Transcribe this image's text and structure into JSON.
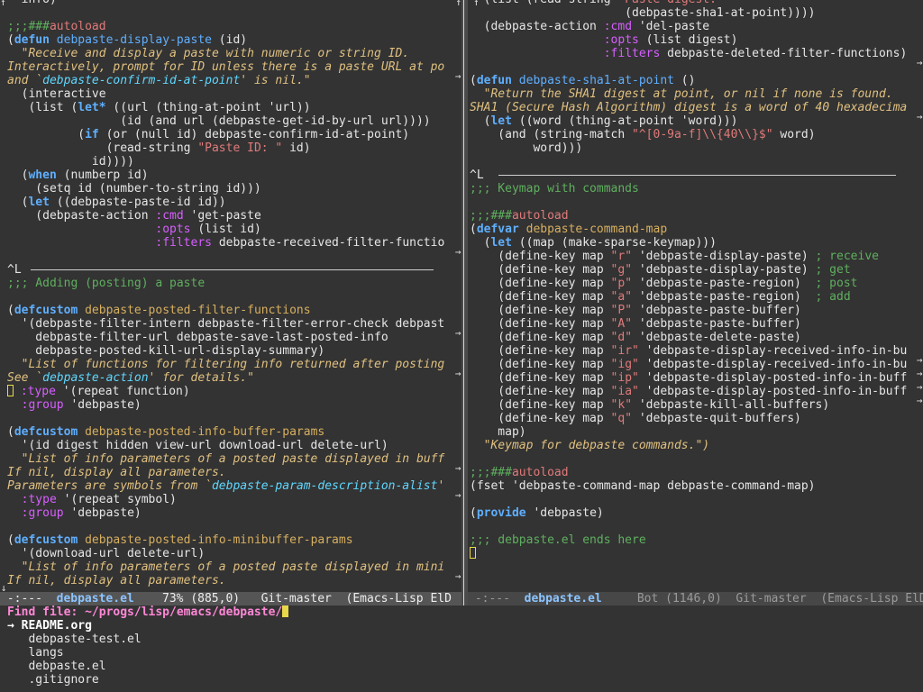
{
  "left_window": {
    "lines": [
      [
        {
          "t": "  info)"
        }
      ],
      [
        {
          "t": ""
        }
      ],
      [
        {
          "t": ";;;###",
          "c": "cm"
        },
        {
          "t": "autoload",
          "c": "str"
        }
      ],
      [
        {
          "t": "(",
          "c": ""
        },
        {
          "t": "defun",
          "c": "kw"
        },
        {
          "t": " ",
          "c": ""
        },
        {
          "t": "debpaste-display-paste",
          "c": "fn"
        },
        {
          "t": " (id)"
        }
      ],
      [
        {
          "t": "  \"Receive and display a paste with numeric or string ID.",
          "c": "doc"
        }
      ],
      [
        {
          "t": "Interactively, prompt for ID unless there is a paste URL at po",
          "c": "doc"
        }
      ],
      [
        {
          "t": "and `",
          "c": "doc"
        },
        {
          "t": "debpaste-confirm-id-at-point",
          "c": "link"
        },
        {
          "t": "' is nil.\"",
          "c": "doc"
        }
      ],
      [
        {
          "t": "  (interactive"
        }
      ],
      [
        {
          "t": "   (list ("
        },
        {
          "t": "let*",
          "c": "kw"
        },
        {
          "t": " ((url (thing-at-point 'url))"
        }
      ],
      [
        {
          "t": "                (id (and url (debpaste-get-id-by-url url))))"
        }
      ],
      [
        {
          "t": "          ("
        },
        {
          "t": "if",
          "c": "kw"
        },
        {
          "t": " (or (null id) debpaste-confirm-id-at-point)"
        }
      ],
      [
        {
          "t": "              (read-string "
        },
        {
          "t": "\"Paste ID: \"",
          "c": "str"
        },
        {
          "t": " id)"
        }
      ],
      [
        {
          "t": "            id))))"
        }
      ],
      [
        {
          "t": "  ("
        },
        {
          "t": "when",
          "c": "kw"
        },
        {
          "t": " (numberp id)"
        }
      ],
      [
        {
          "t": "    (setq id (number-to-string id)))"
        }
      ],
      [
        {
          "t": "  ("
        },
        {
          "t": "let",
          "c": "kw"
        },
        {
          "t": " ((debpaste-paste-id id))"
        }
      ],
      [
        {
          "t": "    (debpaste-action "
        },
        {
          "t": ":cmd",
          "c": "cmd"
        },
        {
          "t": " 'get-paste"
        }
      ],
      [
        {
          "t": "                     "
        },
        {
          "t": ":opts",
          "c": "cmd"
        },
        {
          "t": " (list id)"
        }
      ],
      [
        {
          "t": "                     "
        },
        {
          "t": ":filters",
          "c": "cmd"
        },
        {
          "t": " debpaste-received-filter-functio"
        }
      ],
      [
        {
          "t": ""
        }
      ],
      [
        {
          "t": "^L",
          "ff": true
        }
      ],
      [
        {
          "t": ";;; Adding (posting) a paste",
          "c": "cm"
        }
      ],
      [
        {
          "t": ""
        }
      ],
      [
        {
          "t": "(",
          "c": ""
        },
        {
          "t": "defcustom",
          "c": "kw"
        },
        {
          "t": " "
        },
        {
          "t": "debpaste-posted-filter-functions",
          "c": "var"
        }
      ],
      [
        {
          "t": "  '(debpaste-filter-intern debpaste-filter-error-check debpast"
        }
      ],
      [
        {
          "t": "    debpaste-filter-url debpaste-save-last-posted-info"
        }
      ],
      [
        {
          "t": "    debpaste-posted-kill-url-display-summary)"
        }
      ],
      [
        {
          "t": "  \"List of functions for filtering info returned after posting",
          "c": "doc"
        }
      ],
      [
        {
          "t": "See `",
          "c": "doc"
        },
        {
          "t": "debpaste-action",
          "c": "link"
        },
        {
          "t": "' for details.\"",
          "c": "doc"
        }
      ],
      [
        {
          "t": "",
          "cur": true
        },
        {
          "t": " "
        },
        {
          "t": ":type",
          "c": "cmd"
        },
        {
          "t": " '(repeat function)"
        }
      ],
      [
        {
          "t": "  "
        },
        {
          "t": ":group",
          "c": "cmd"
        },
        {
          "t": " 'debpaste)"
        }
      ],
      [
        {
          "t": ""
        }
      ],
      [
        {
          "t": "(",
          "c": ""
        },
        {
          "t": "defcustom",
          "c": "kw"
        },
        {
          "t": " "
        },
        {
          "t": "debpaste-posted-info-buffer-params",
          "c": "var"
        }
      ],
      [
        {
          "t": "  '(id digest hidden view-url download-url delete-url)"
        }
      ],
      [
        {
          "t": "  \"List of info parameters of a posted paste displayed in buff",
          "c": "doc"
        }
      ],
      [
        {
          "t": "If nil, display all parameters.",
          "c": "doc"
        }
      ],
      [
        {
          "t": "Parameters are symbols from `",
          "c": "doc"
        },
        {
          "t": "debpaste-param-description-alist",
          "c": "link"
        },
        {
          "t": "'",
          "c": "doc"
        }
      ],
      [
        {
          "t": "  "
        },
        {
          "t": ":type",
          "c": "cmd"
        },
        {
          "t": " '(repeat symbol)"
        }
      ],
      [
        {
          "t": "  "
        },
        {
          "t": ":group",
          "c": "cmd"
        },
        {
          "t": " 'debpaste)"
        }
      ],
      [
        {
          "t": ""
        }
      ],
      [
        {
          "t": "(",
          "c": ""
        },
        {
          "t": "defcustom",
          "c": "kw"
        },
        {
          "t": " "
        },
        {
          "t": "debpaste-posted-info-minibuffer-params",
          "c": "var"
        }
      ],
      [
        {
          "t": "  '(download-url delete-url)"
        }
      ],
      [
        {
          "t": "  \"List of info parameters of a posted paste displayed in mini",
          "c": "doc"
        }
      ],
      [
        {
          "t": "If nil, display all parameters.",
          "c": "doc"
        }
      ]
    ]
  },
  "right_window": {
    "lines": [
      [
        {
          "t": "  (list (read-string "
        },
        {
          "t": "\"Paste digest: \"",
          "c": "str"
        }
      ],
      [
        {
          "t": "                      (debpaste-sha1-at-point))))"
        }
      ],
      [
        {
          "t": "  (debpaste-action "
        },
        {
          "t": ":cmd",
          "c": "cmd"
        },
        {
          "t": " 'del-paste"
        }
      ],
      [
        {
          "t": "                   "
        },
        {
          "t": ":opts",
          "c": "cmd"
        },
        {
          "t": " (list digest)"
        }
      ],
      [
        {
          "t": "                   "
        },
        {
          "t": ":filters",
          "c": "cmd"
        },
        {
          "t": " debpaste-deleted-filter-functions)"
        }
      ],
      [
        {
          "t": ""
        }
      ],
      [
        {
          "t": "(",
          "c": ""
        },
        {
          "t": "defun",
          "c": "kw"
        },
        {
          "t": " "
        },
        {
          "t": "debpaste-sha1-at-point",
          "c": "fn"
        },
        {
          "t": " ()"
        }
      ],
      [
        {
          "t": "  \"Return the SHA1 digest at point, or nil if none is found.",
          "c": "doc"
        }
      ],
      [
        {
          "t": "SHA1 (Secure Hash Algorithm) digest is a word of 40 hexadecima",
          "c": "doc"
        }
      ],
      [
        {
          "t": "  ("
        },
        {
          "t": "let",
          "c": "kw"
        },
        {
          "t": " ((word (thing-at-point 'word)))"
        }
      ],
      [
        {
          "t": "    (and (string-match "
        },
        {
          "t": "\"^[0-9a-f]\\\\{40\\\\}$\"",
          "c": "str"
        },
        {
          "t": " word)"
        }
      ],
      [
        {
          "t": "         word)))"
        }
      ],
      [
        {
          "t": ""
        }
      ],
      [
        {
          "t": "^L",
          "ff": true
        }
      ],
      [
        {
          "t": ";;; Keymap with commands",
          "c": "cm"
        }
      ],
      [
        {
          "t": ""
        }
      ],
      [
        {
          "t": ";;;###",
          "c": "cm"
        },
        {
          "t": "autoload",
          "c": "str"
        }
      ],
      [
        {
          "t": "(",
          "c": ""
        },
        {
          "t": "defvar",
          "c": "kw"
        },
        {
          "t": " "
        },
        {
          "t": "debpaste-command-map",
          "c": "var"
        }
      ],
      [
        {
          "t": "  ("
        },
        {
          "t": "let",
          "c": "kw"
        },
        {
          "t": " ((map (make-sparse-keymap)))"
        }
      ],
      [
        {
          "t": "    (define-key map "
        },
        {
          "t": "\"r\"",
          "c": "str"
        },
        {
          "t": " 'debpaste-display-paste) "
        },
        {
          "t": "; receive",
          "c": "cm"
        }
      ],
      [
        {
          "t": "    (define-key map "
        },
        {
          "t": "\"g\"",
          "c": "str"
        },
        {
          "t": " 'debpaste-display-paste) "
        },
        {
          "t": "; get",
          "c": "cm"
        }
      ],
      [
        {
          "t": "    (define-key map "
        },
        {
          "t": "\"p\"",
          "c": "str"
        },
        {
          "t": " 'debpaste-paste-region)  "
        },
        {
          "t": "; post",
          "c": "cm"
        }
      ],
      [
        {
          "t": "    (define-key map "
        },
        {
          "t": "\"a\"",
          "c": "str"
        },
        {
          "t": " 'debpaste-paste-region)  "
        },
        {
          "t": "; add",
          "c": "cm"
        }
      ],
      [
        {
          "t": "    (define-key map "
        },
        {
          "t": "\"P\"",
          "c": "str"
        },
        {
          "t": " 'debpaste-paste-buffer)"
        }
      ],
      [
        {
          "t": "    (define-key map "
        },
        {
          "t": "\"A\"",
          "c": "str"
        },
        {
          "t": " 'debpaste-paste-buffer)"
        }
      ],
      [
        {
          "t": "    (define-key map "
        },
        {
          "t": "\"d\"",
          "c": "str"
        },
        {
          "t": " 'debpaste-delete-paste)"
        }
      ],
      [
        {
          "t": "    (define-key map "
        },
        {
          "t": "\"ir\"",
          "c": "str"
        },
        {
          "t": " 'debpaste-display-received-info-in-bu"
        }
      ],
      [
        {
          "t": "    (define-key map "
        },
        {
          "t": "\"ig\"",
          "c": "str"
        },
        {
          "t": " 'debpaste-display-received-info-in-bu"
        }
      ],
      [
        {
          "t": "    (define-key map "
        },
        {
          "t": "\"ip\"",
          "c": "str"
        },
        {
          "t": " 'debpaste-display-posted-info-in-buff"
        }
      ],
      [
        {
          "t": "    (define-key map "
        },
        {
          "t": "\"ia\"",
          "c": "str"
        },
        {
          "t": " 'debpaste-display-posted-info-in-buff"
        }
      ],
      [
        {
          "t": "    (define-key map "
        },
        {
          "t": "\"k\"",
          "c": "str"
        },
        {
          "t": " 'debpaste-kill-all-buffers)"
        }
      ],
      [
        {
          "t": "    (define-key map "
        },
        {
          "t": "\"q\"",
          "c": "str"
        },
        {
          "t": " 'debpaste-quit-buffers)"
        }
      ],
      [
        {
          "t": "    map)"
        }
      ],
      [
        {
          "t": "  \"Keymap for debpaste commands.\")",
          "c": "doc"
        }
      ],
      [
        {
          "t": ""
        }
      ],
      [
        {
          "t": ";;;###",
          "c": "cm"
        },
        {
          "t": "autoload",
          "c": "str"
        }
      ],
      [
        {
          "t": "(fset 'debpaste-command-map debpaste-command-map)"
        }
      ],
      [
        {
          "t": ""
        }
      ],
      [
        {
          "t": "("
        },
        {
          "t": "provide",
          "c": "kw"
        },
        {
          "t": " 'debpaste)"
        }
      ],
      [
        {
          "t": ""
        }
      ],
      [
        {
          "t": ";;; debpaste.el ends here",
          "c": "cm"
        }
      ],
      [
        {
          "t": "",
          "cur": true,
          "hollow": true
        }
      ]
    ]
  },
  "left_modeline": {
    "prefix": " -:---  ",
    "buffer": "debpaste.el",
    "rest": "    73% (885,0)   Git-master  (Emacs-Lisp ElD"
  },
  "right_modeline": {
    "prefix": " -:---  ",
    "buffer": "debpaste.el",
    "rest": "     Bot (1146,0)  Git-master  (Emacs-Lisp ElD"
  },
  "minibuffer": {
    "prompt": "Find file: ",
    "path": "~/progs/lisp/emacs/debpaste/",
    "candidates": [
      {
        "label": "README.org",
        "selected": true
      },
      {
        "label": "debpaste-test.el",
        "selected": false
      },
      {
        "label": "langs",
        "selected": false
      },
      {
        "label": "debpaste.el",
        "selected": false
      },
      {
        "label": ".gitignore",
        "selected": false
      }
    ],
    "selection_arrow": "→"
  },
  "colors": {
    "background": "#333333",
    "keyword": "#5fafff",
    "string": "#e07a7a",
    "comment": "#5faf5f",
    "docstring": "#e0c080",
    "cursor": "#e8d84a"
  }
}
